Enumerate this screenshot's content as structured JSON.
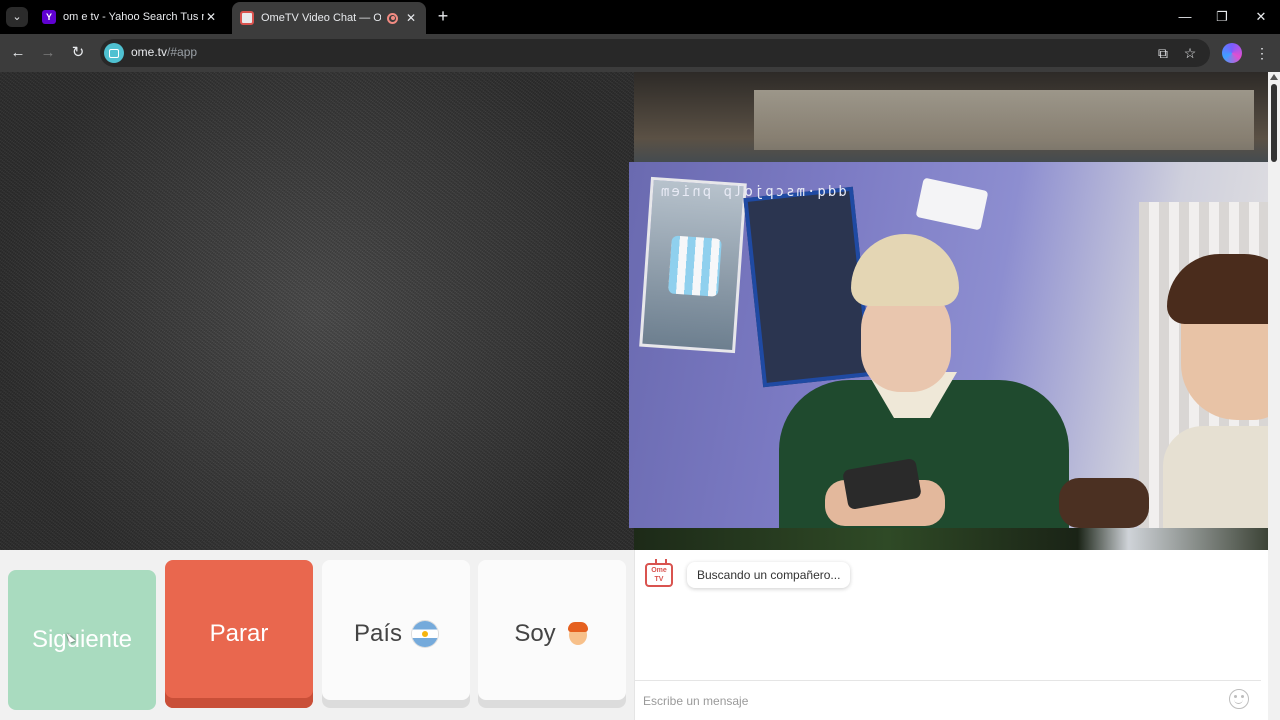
{
  "browser": {
    "tabs": [
      {
        "title": "om e tv - Yahoo Search Tus resu",
        "favicon": "yahoo-icon",
        "active": false
      },
      {
        "title": "OmeTV Video Chat — Ome",
        "favicon": "ometv-icon",
        "active": true,
        "recording": true
      }
    ],
    "new_tab_symbol": "+",
    "window_controls": {
      "minimize": "—",
      "maximize": "❐",
      "close": "✕"
    },
    "nav": {
      "back": "←",
      "forward": "→",
      "reload": "↻"
    },
    "url": {
      "host": "ome.tv",
      "path": "/#app"
    },
    "toolbar_icons": {
      "install": "⧉",
      "bookmark": "☆",
      "menu": "⋮"
    }
  },
  "remote_video": {
    "overlay_text": "ddq·mscpjolp pniem"
  },
  "controls": {
    "next_label": "Siguiente",
    "stop_label": "Parar",
    "country_label": "País",
    "country_flag": "argentina-flag-icon",
    "gender_label": "Soy",
    "gender_icon": "boy-icon"
  },
  "chat": {
    "logo_text": "Ome TV",
    "status_message": "Buscando un compañero...",
    "input_placeholder": "Escribe un mensaje"
  },
  "colors": {
    "next": "#a9dbbf",
    "stop": "#e9674e",
    "brand_red": "#d9534f"
  }
}
